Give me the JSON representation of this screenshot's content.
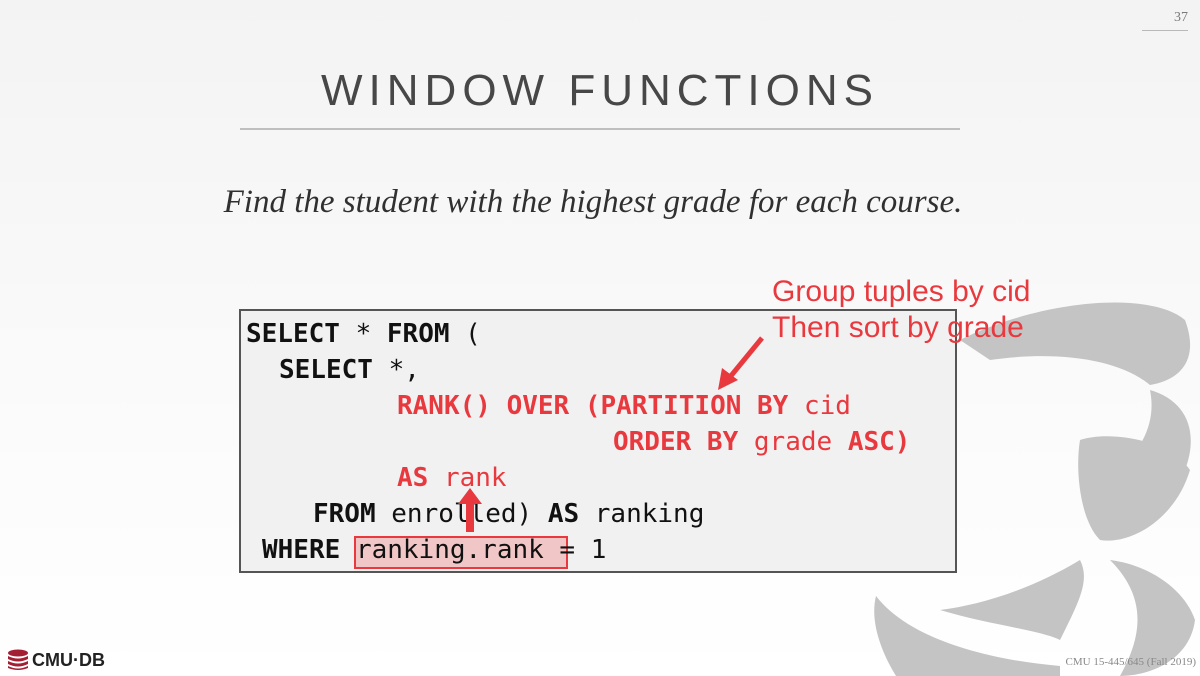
{
  "slide": {
    "page_number": "37",
    "title": "WINDOW FUNCTIONS",
    "subtitle": "Find the student with the highest grade for each course."
  },
  "code": {
    "line1": {
      "k1": "SELECT",
      "t1": " * ",
      "k2": "FROM",
      "t2": " ("
    },
    "line2": {
      "k1": "SELECT",
      "t1": " *,"
    },
    "line3": {
      "r1": "RANK() OVER (PARTITION BY",
      "t1": " cid"
    },
    "line4": {
      "r1": "ORDER BY",
      "t1": " grade ",
      "r2": "ASC)"
    },
    "line5": {
      "r1": "AS",
      "t1": " rank"
    },
    "line6": {
      "k1": "FROM",
      "t1": " enrolled) ",
      "k2": "AS",
      "t2": " ranking"
    },
    "line7": {
      "k1": "WHERE",
      "t1": " ",
      "h1": "ranking.rank",
      "t2": " = 1"
    }
  },
  "annotation": {
    "line1": "Group tuples by cid",
    "line2": "Then sort by grade"
  },
  "footer": {
    "logo_text": "CMU·DB",
    "course": "CMU 15-445/645 (Fall 2019)"
  },
  "colors": {
    "accent": "#e8393f",
    "highlight_fill": "#f1c6c6"
  }
}
